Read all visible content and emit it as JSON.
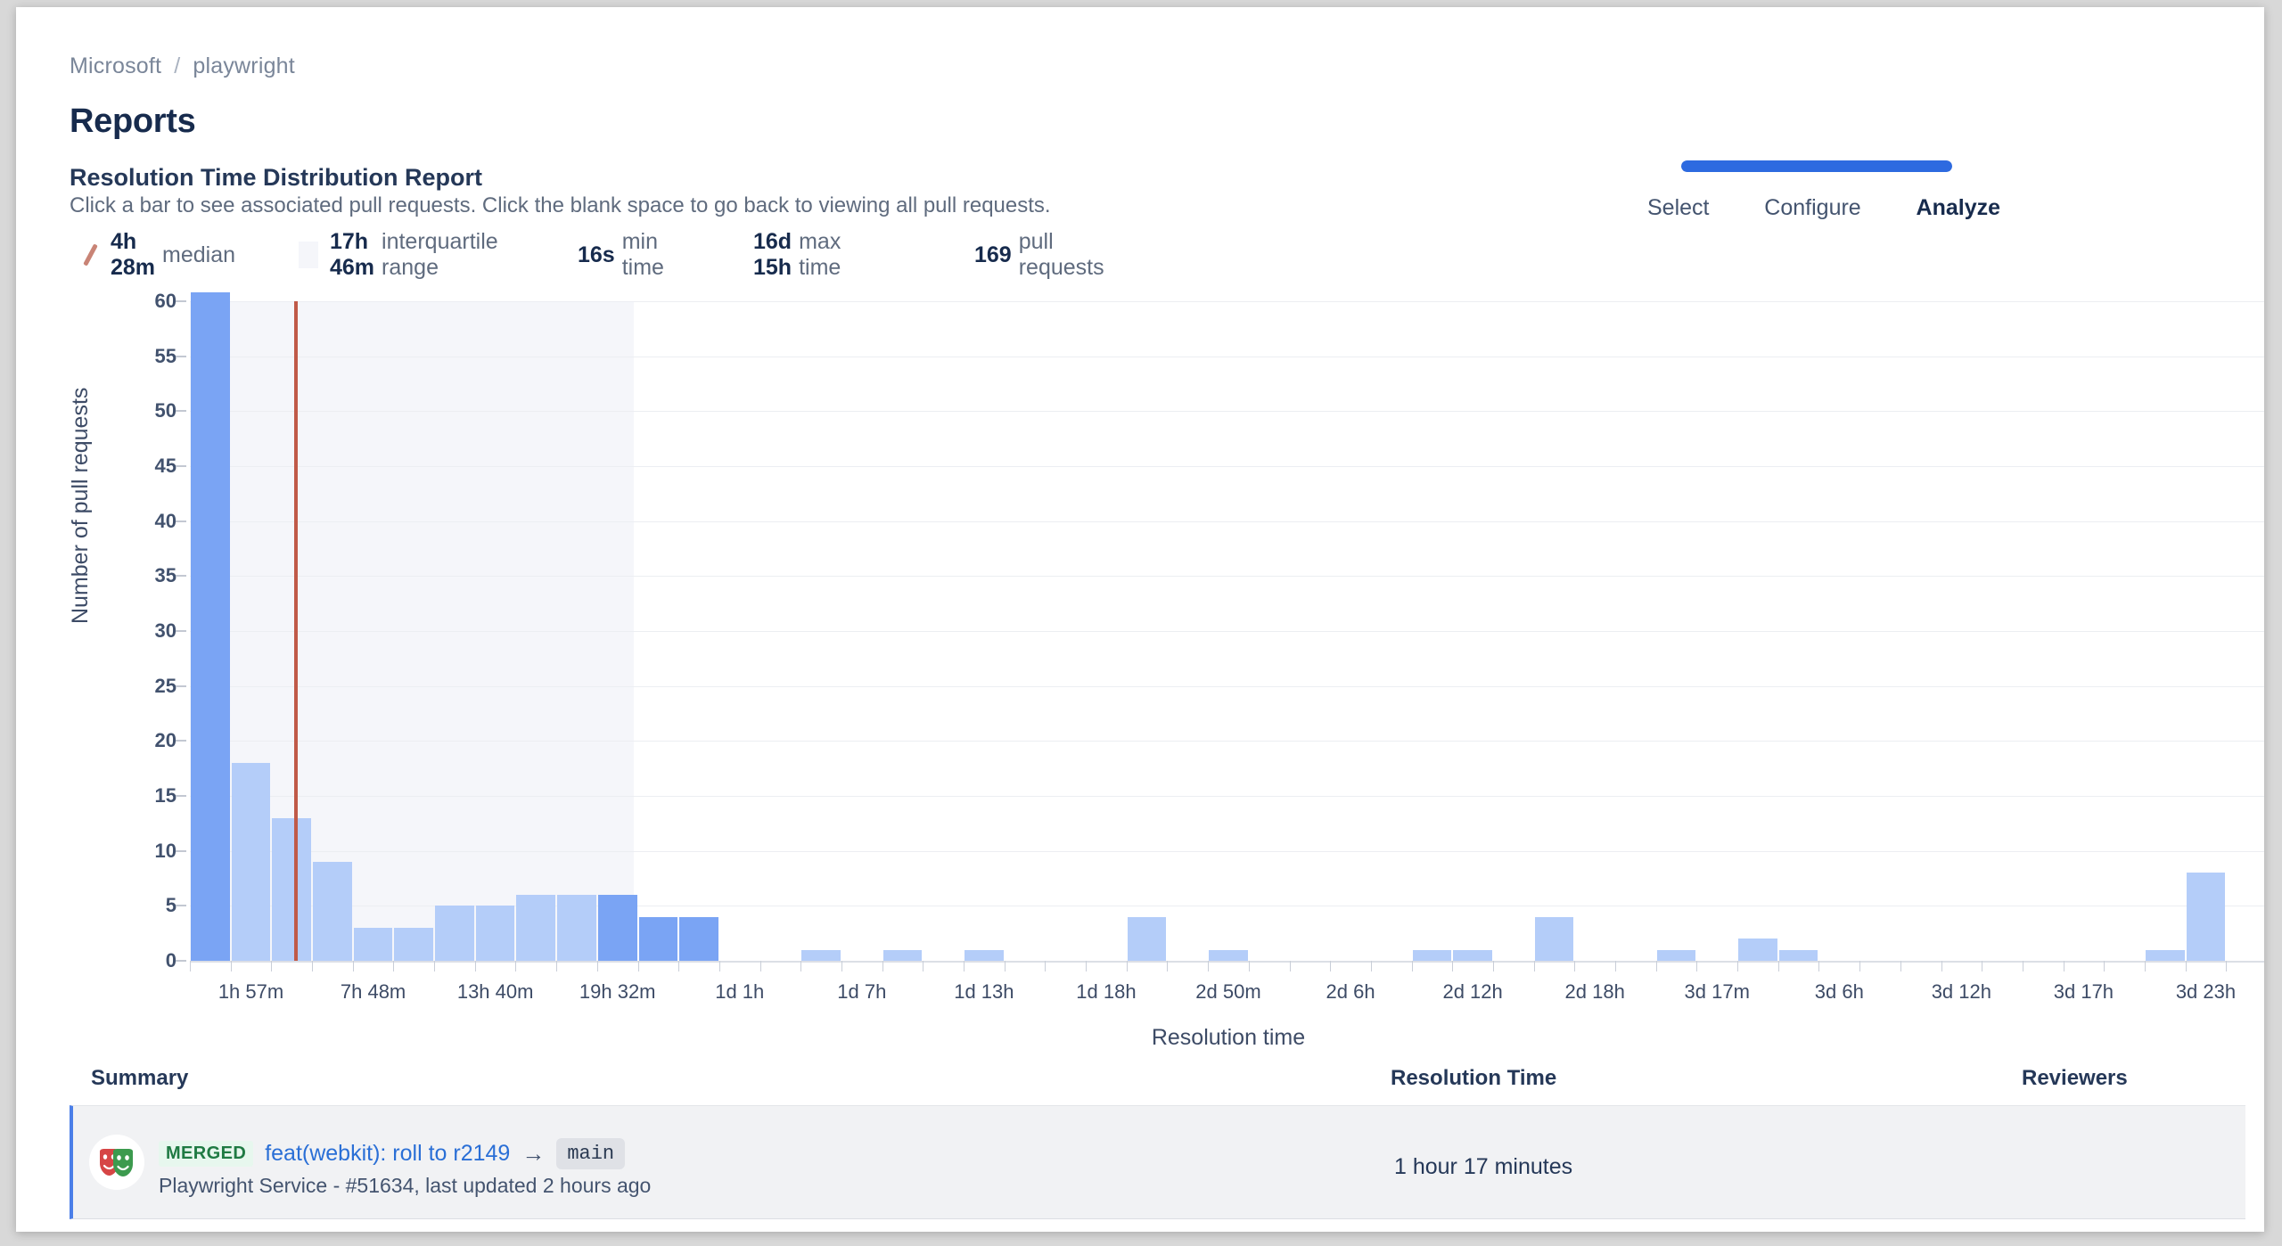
{
  "breadcrumb": {
    "org": "Microsoft",
    "separator": "/",
    "repo": "playwright"
  },
  "page_title": "Reports",
  "report": {
    "title": "Resolution Time Distribution Report",
    "subtitle": "Click a bar to see associated pull requests. Click the blank space to go back to viewing all pull requests."
  },
  "stepper": {
    "progress_percent": 100,
    "fill_color": "#2d6ae0",
    "steps": [
      {
        "label": "Select",
        "active": false
      },
      {
        "label": "Configure",
        "active": false
      },
      {
        "label": "Analyze",
        "active": true
      }
    ]
  },
  "stats": [
    {
      "icon": "median-line-icon",
      "value": "4h 28m",
      "label": "median"
    },
    {
      "icon": "iqr-swatch-icon",
      "value": "17h 46m",
      "label": "interquartile range"
    },
    {
      "icon": "",
      "value": "16s",
      "label": "min time"
    },
    {
      "icon": "",
      "value": "16d 15h",
      "label": "max time"
    },
    {
      "icon": "",
      "value": "169",
      "label": "pull requests"
    }
  ],
  "chart_data": {
    "type": "bar",
    "title": "Resolution Time Distribution Report",
    "xlabel": "Resolution time",
    "ylabel": "Number of pull requests",
    "ylim": [
      0,
      60
    ],
    "yticks": [
      0,
      5,
      10,
      15,
      20,
      25,
      30,
      35,
      40,
      45,
      50,
      55,
      60
    ],
    "grid": true,
    "legend_position": "top",
    "xtick_labels": [
      "1h 57m",
      "7h 48m",
      "13h 40m",
      "19h 32m",
      "1d 1h",
      "1d 7h",
      "1d 13h",
      "1d 18h",
      "2d 50m",
      "2d 6h",
      "2d 12h",
      "2d 18h",
      "3d 17m",
      "3d 6h",
      "3d 12h",
      "3d 17h",
      "3d 23h"
    ],
    "xtick_bin_index": [
      1,
      4,
      7,
      10,
      13,
      16,
      19,
      22,
      25,
      28,
      31,
      34,
      37,
      40,
      43,
      46,
      49
    ],
    "bin_count": 51,
    "values": [
      60,
      18,
      13,
      9,
      3,
      3,
      5,
      5,
      6,
      6,
      6,
      4,
      4,
      0,
      0,
      1,
      0,
      1,
      0,
      1,
      0,
      0,
      0,
      4,
      0,
      1,
      0,
      0,
      0,
      0,
      1,
      1,
      0,
      4,
      0,
      0,
      1,
      0,
      2,
      1,
      0,
      0,
      0,
      0,
      0,
      0,
      0,
      0,
      1,
      8,
      0
    ],
    "selected_bins": [
      0,
      10,
      11,
      12
    ],
    "truncated_first_bar": true,
    "bar_color": "#b4cdf9",
    "bar_color_selected": "#7aa4f4",
    "median_marker": {
      "value": "4h 28m",
      "bin_position": 2.55,
      "color": "#c05a48"
    },
    "iqr_band": {
      "from": "16s",
      "to": "17h 46m",
      "start_bin": 0,
      "end_bin": 10.9,
      "color": "#f5f6fa"
    }
  },
  "table": {
    "columns": [
      "Summary",
      "Resolution Time",
      "Reviewers"
    ],
    "rows": [
      {
        "avatar": "playwright-masks-avatar",
        "status": "MERGED",
        "title": "feat(webkit): roll to r2149",
        "arrow": "→",
        "branch": "main",
        "meta": "Playwright Service - #51634, last updated 2 hours ago",
        "resolution_time": "1 hour 17 minutes",
        "reviewers": ""
      }
    ]
  }
}
